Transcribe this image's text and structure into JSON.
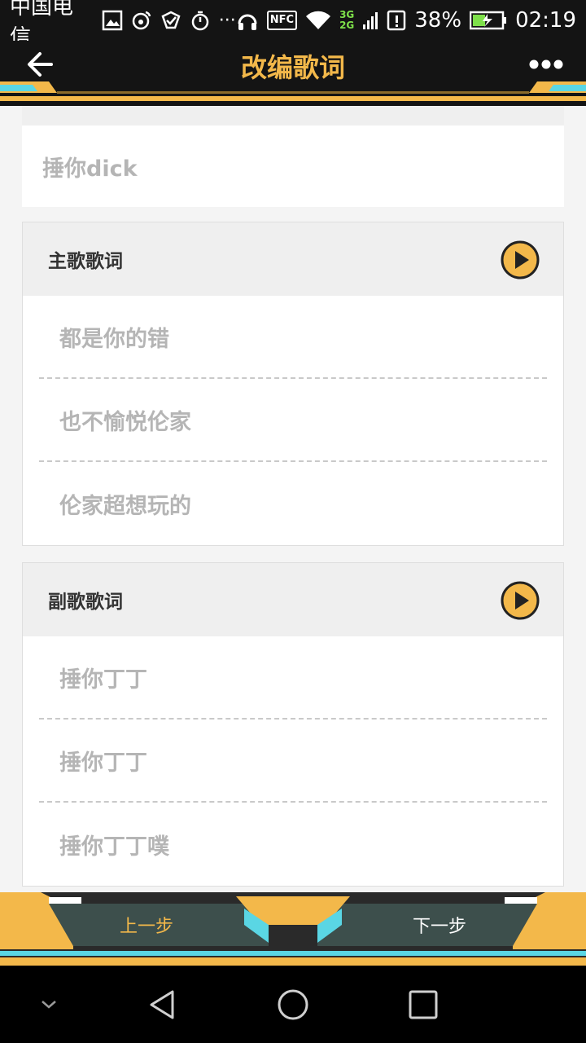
{
  "status_bar": {
    "carrier": "中国电信",
    "more": "···",
    "nfc": "NFC",
    "net_3g": "3G",
    "net_2g": "2G",
    "battery": "38%",
    "time": "02:19"
  },
  "header": {
    "title": "改编歌词",
    "back_icon": "arrow-left-icon",
    "more_icon": "more-dots-icon",
    "accent": "#f3b84a"
  },
  "top_section": {
    "line": "捶你dick"
  },
  "sections": [
    {
      "label": "主歌歌词",
      "lines": [
        "都是你的错",
        "也不愉悦伦家",
        "伦家超想玩的"
      ]
    },
    {
      "label": "副歌歌词",
      "lines": [
        "捶你丁丁",
        "捶你丁丁",
        "捶你丁丁噗"
      ]
    }
  ],
  "bottom_bar": {
    "prev_label": "上一步",
    "next_label": "下一步"
  },
  "nav_bar": {
    "icons": [
      "chevron-down-icon",
      "back-triangle-icon",
      "home-circle-icon",
      "recents-square-icon"
    ]
  }
}
